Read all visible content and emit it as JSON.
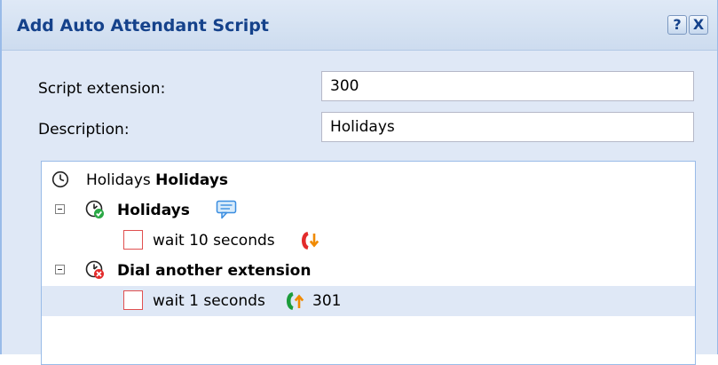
{
  "dialog": {
    "title": "Add Auto Attendant Script",
    "help_glyph": "?",
    "close_glyph": "X"
  },
  "form": {
    "script_extension_label": "Script extension:",
    "script_extension_value": "300",
    "description_label": "Description:",
    "description_value": "Holidays"
  },
  "tree": {
    "root": {
      "icon": "clock-icon",
      "label_plain": "Holidays",
      "label_bold": "Holidays"
    },
    "nodes": [
      {
        "label": "Holidays",
        "expander_state": "expanded",
        "icon": "schedule-check-icon",
        "badge_icon": "speech-bubble-icon",
        "children": [
          {
            "text": "wait 10 seconds",
            "icon": "call-in-red-icon",
            "number": ""
          }
        ]
      },
      {
        "label": "Dial another extension",
        "expander_state": "expanded",
        "icon": "schedule-cancel-icon",
        "children": [
          {
            "text": "wait 1 seconds",
            "icon": "call-out-green-icon",
            "number": "301",
            "selected": true
          }
        ]
      }
    ]
  },
  "colors": {
    "title_text": "#15428b",
    "panel_bg": "#dfe8f6",
    "selected_row": "#dfe8f6",
    "red_call": "#e32b2b",
    "green_call": "#1c9c3b",
    "orange_arrow": "#f08a00",
    "bubble_blue": "#3a8de0"
  }
}
